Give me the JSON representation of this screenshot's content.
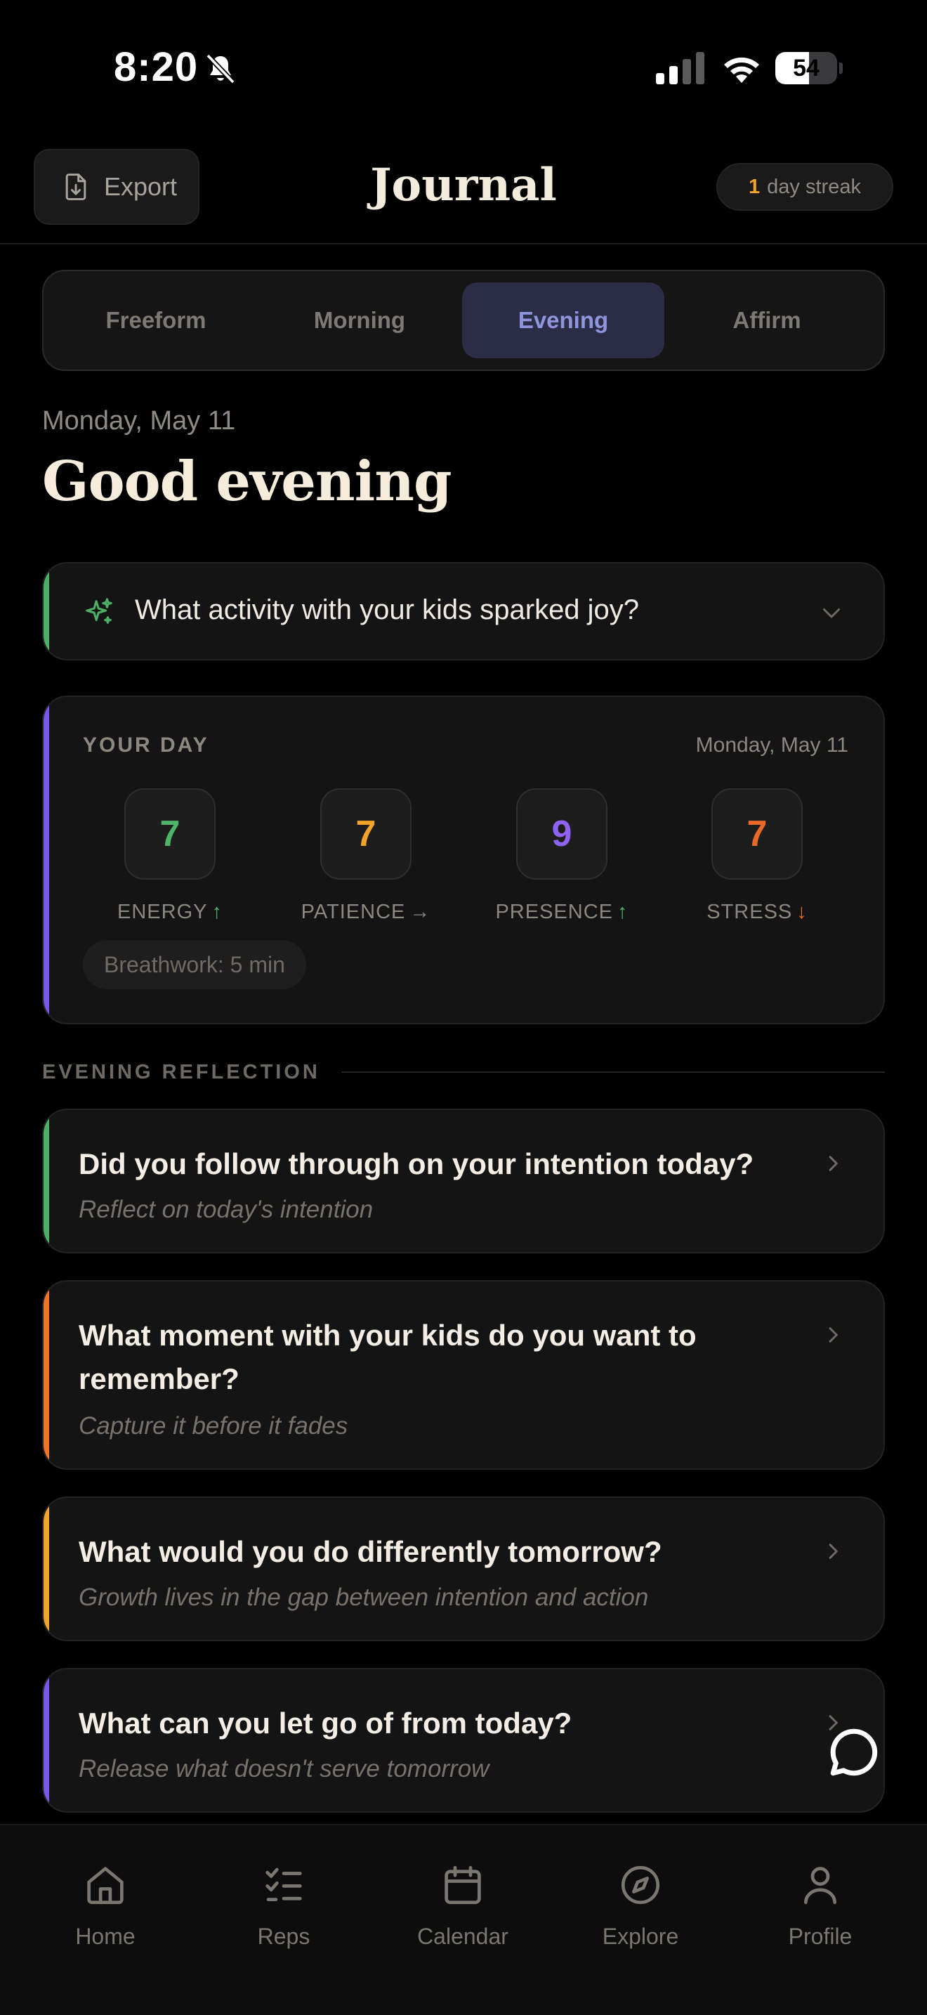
{
  "status_bar": {
    "time": "8:20",
    "battery_level": "54",
    "battery_fraction": 0.54
  },
  "header": {
    "export_label": "Export",
    "title": "Journal",
    "streak_count": "1",
    "streak_text": "day streak"
  },
  "tabs": [
    {
      "label": "Freeform",
      "active": false
    },
    {
      "label": "Morning",
      "active": false
    },
    {
      "label": "Evening",
      "active": true
    },
    {
      "label": "Affirm",
      "active": false
    }
  ],
  "date_line": "Monday, May 11",
  "greeting": "Good evening",
  "prompt": {
    "text": "What activity with your kids sparked joy?",
    "accent": "#4caf64"
  },
  "your_day": {
    "title": "YOUR DAY",
    "date": "Monday, May 11",
    "accent": "#7b55e8",
    "metrics": [
      {
        "value": "7",
        "label": "ENERGY",
        "arrow": "↑",
        "value_color": "#4fb36a",
        "arrow_color": "#4fb36a"
      },
      {
        "value": "7",
        "label": "PATIENCE",
        "arrow": "→",
        "value_color": "#f0a52a",
        "arrow_color": "#8d887f"
      },
      {
        "value": "9",
        "label": "PRESENCE",
        "arrow": "↑",
        "value_color": "#8e63f0",
        "arrow_color": "#4fb36a"
      },
      {
        "value": "7",
        "label": "STRESS",
        "arrow": "↓",
        "value_color": "#e8692a",
        "arrow_color": "#e8692a"
      }
    ],
    "chip": "Breathwork: 5 min"
  },
  "section_title": "EVENING REFLECTION",
  "reflections": [
    {
      "question": "Did you follow through on your intention today?",
      "subtitle": "Reflect on today's intention",
      "accent": "#4caf64"
    },
    {
      "question": "What moment with your kids do you want to remember?",
      "subtitle": "Capture it before it fades",
      "accent": "#f07528"
    },
    {
      "question": "What would you do differently tomorrow?",
      "subtitle": "Growth lives in the gap between intention and action",
      "accent": "#f0a52a"
    },
    {
      "question": "What can you let go of from today?",
      "subtitle": "Release what doesn't serve tomorrow",
      "accent": "#7b55e8"
    }
  ],
  "nav": [
    {
      "label": "Home",
      "icon": "home-icon"
    },
    {
      "label": "Reps",
      "icon": "checklist-icon"
    },
    {
      "label": "Calendar",
      "icon": "calendar-icon"
    },
    {
      "label": "Explore",
      "icon": "compass-icon"
    },
    {
      "label": "Profile",
      "icon": "person-icon"
    }
  ],
  "floating_action": {
    "icon": "chat-bubble-icon"
  }
}
